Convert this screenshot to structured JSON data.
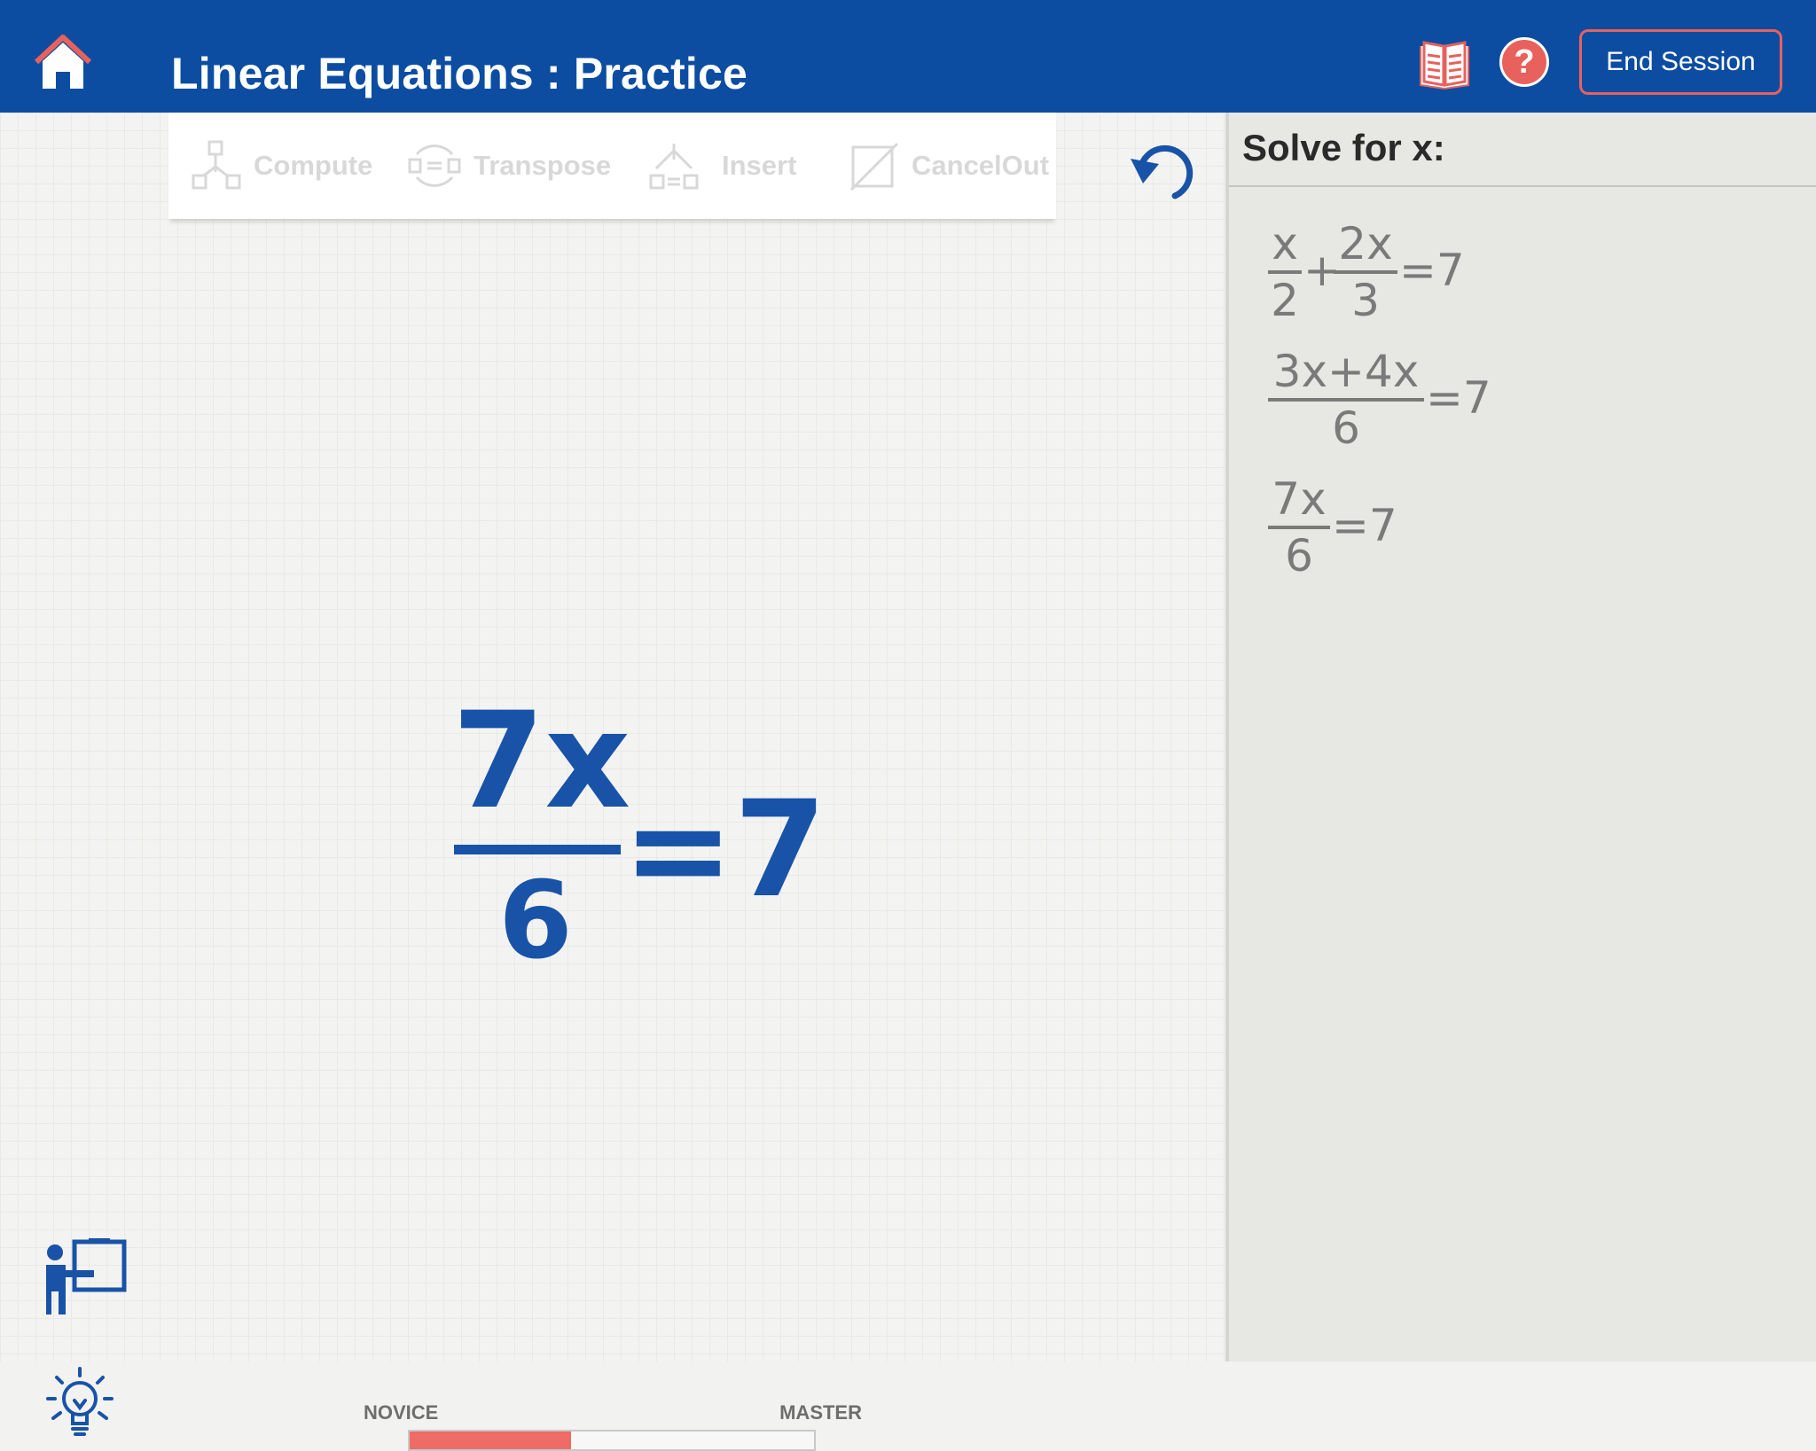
{
  "header": {
    "title": "Linear Equations : Practice",
    "help_label": "?",
    "end_session_label": "End Session"
  },
  "toolbar": {
    "tools": [
      {
        "label": "Compute",
        "icon": "compute-icon"
      },
      {
        "label": "Transpose",
        "icon": "transpose-icon"
      },
      {
        "label": "Insert",
        "icon": "insert-icon"
      },
      {
        "label": "CancelOut",
        "icon": "cancel-out-icon"
      }
    ]
  },
  "equation": {
    "numerator": "7x",
    "denominator": "6",
    "rhs": "=7"
  },
  "progress": {
    "start_label": "NOVICE",
    "end_label": "MASTER",
    "level": 0.4
  },
  "panel": {
    "title": "Solve for x:",
    "steps": [
      {
        "fracs": [
          {
            "n": "x",
            "d": "2"
          },
          {
            "n": "2x",
            "d": "3"
          }
        ],
        "ops": [
          "+",
          "=7"
        ]
      },
      {
        "fracs": [
          {
            "n": "3x+4x",
            "d": "6"
          }
        ],
        "ops": [
          "=7"
        ]
      },
      {
        "fracs": [
          {
            "n": "7x",
            "d": "6"
          }
        ],
        "ops": [
          "=7"
        ]
      }
    ]
  },
  "colors": {
    "header": "#0c4da2",
    "accent": "#e8615c",
    "equation": "#1853a8",
    "progress_fill": "#ee6b66"
  }
}
